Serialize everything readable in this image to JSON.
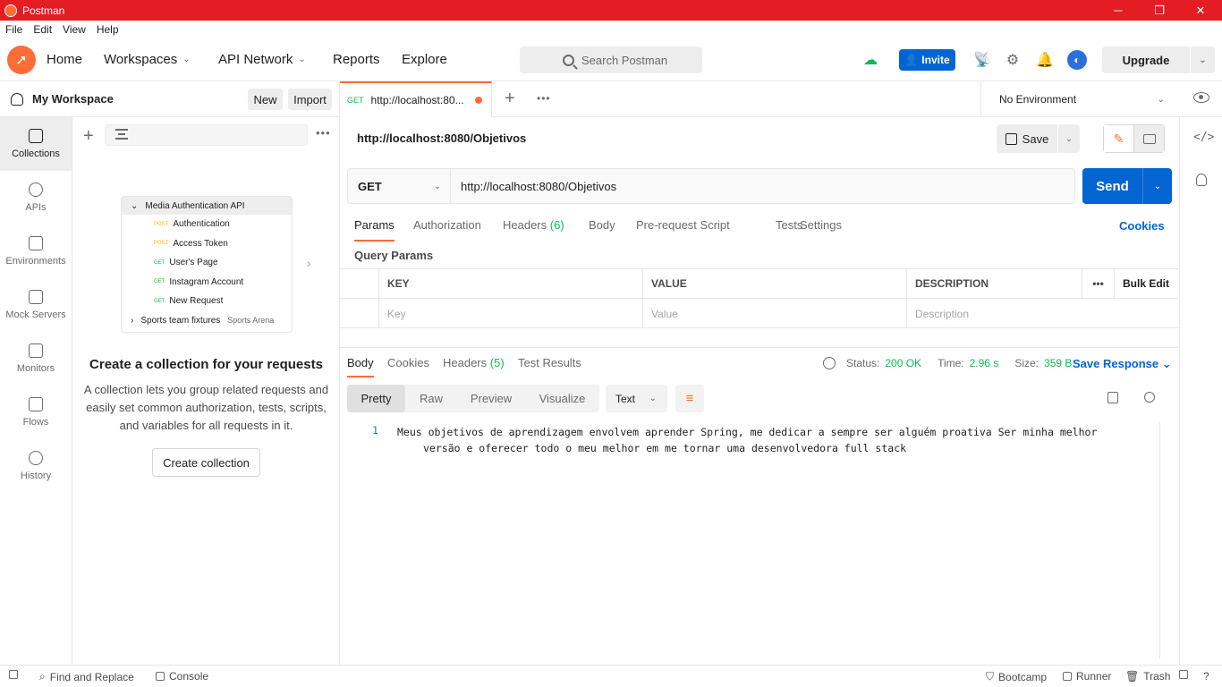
{
  "titlebar": {
    "title": "Postman",
    "minimize": "─",
    "restore": "❐",
    "close": "✕"
  },
  "menu": [
    "File",
    "Edit",
    "View",
    "Help"
  ],
  "header": {
    "nav": {
      "home": "Home",
      "workspaces": "Workspaces",
      "api_network": "API Network",
      "reports": "Reports",
      "explore": "Explore"
    },
    "search_placeholder": "Search Postman",
    "invite": "Invite",
    "upgrade": "Upgrade"
  },
  "workspace": {
    "title": "My Workspace",
    "new": "New",
    "import": "Import"
  },
  "rail": [
    "Collections",
    "APIs",
    "Environments",
    "Mock Servers",
    "Monitors",
    "Flows",
    "History"
  ],
  "collections_pane": {
    "illustration": {
      "collection": "Media Authentication API",
      "requests": [
        {
          "method": "POST",
          "name": "Authentication"
        },
        {
          "method": "POST",
          "name": "Access Token"
        },
        {
          "method": "GET",
          "name": "User's Page"
        },
        {
          "method": "GET",
          "name": "Instagram Account"
        },
        {
          "method": "GET",
          "name": "New Request"
        }
      ],
      "second_collection": "Sports team fixtures",
      "second_sub": "Sports Arena"
    },
    "heading": "Create a collection for your requests",
    "description": "A collection lets you group related requests and easily set common authorization, tests, scripts, and variables for all requests in it.",
    "create_button": "Create collection"
  },
  "tab": {
    "method": "GET",
    "url": "http://localhost:80..."
  },
  "environment": "No Environment",
  "request": {
    "title": "http://localhost:8080/Objetivos",
    "save": "Save",
    "method": "GET",
    "url": "http://localhost:8080/Objetivos",
    "send": "Send",
    "tabs": {
      "params": "Params",
      "authorization": "Authorization",
      "headers": "Headers",
      "headers_count": "(6)",
      "body": "Body",
      "prerequest": "Pre-request Script",
      "tests": "Tests",
      "settings": "Settings"
    },
    "cookies": "Cookies",
    "query_params_title": "Query Params",
    "table": {
      "headers": {
        "key": "KEY",
        "value": "VALUE",
        "description": "DESCRIPTION",
        "more": "•••",
        "bulk_edit": "Bulk Edit"
      },
      "placeholders": {
        "key": "Key",
        "value": "Value",
        "description": "Description"
      }
    }
  },
  "response": {
    "tabs": {
      "body": "Body",
      "cookies": "Cookies",
      "headers": "Headers",
      "headers_count": "(5)",
      "test_results": "Test Results"
    },
    "status_label": "Status:",
    "status_value": "200 OK",
    "time_label": "Time:",
    "time_value": "2.96 s",
    "size_label": "Size:",
    "size_value": "359 B",
    "save_response": "Save Response",
    "views": {
      "pretty": "Pretty",
      "raw": "Raw",
      "preview": "Preview",
      "visualize": "Visualize"
    },
    "format": "Text",
    "line_number": "1",
    "body_text": "Meus objetivos de aprendizagem envolvem aprender Spring, me dedicar a sempre ser alguém proativa Ser minha melhor versão e oferecer todo o meu melhor em me tornar uma desenvolvedora full stack"
  },
  "statusbar": {
    "find_replace": "Find and Replace",
    "console": "Console",
    "bootcamp": "Bootcamp",
    "runner": "Runner",
    "trash": "Trash"
  },
  "colors": {
    "brand": "#ff6c37",
    "primary": "#0265d2",
    "success": "#0cbb52",
    "titlebar": "#e31d23"
  }
}
